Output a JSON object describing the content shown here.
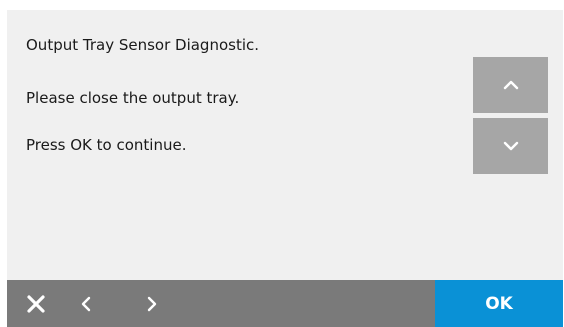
{
  "dialog": {
    "title_line": "Output Tray Sensor Diagnostic.",
    "instruction_line": "Please close the output tray.",
    "continue_line": "Press OK to continue."
  },
  "scroll": {
    "up_icon": "chevron-up-icon",
    "down_icon": "chevron-down-icon"
  },
  "bottom_bar": {
    "close_icon": "close-icon",
    "back_icon": "chevron-left-icon",
    "forward_icon": "chevron-right-icon",
    "ok_label": "OK"
  },
  "colors": {
    "screen_background": "#f0f0f0",
    "scroll_button": "#a6a6a6",
    "bottom_bar": "#7a7a7a",
    "ok_button": "#0a91d6",
    "text": "#1a1a1a"
  }
}
